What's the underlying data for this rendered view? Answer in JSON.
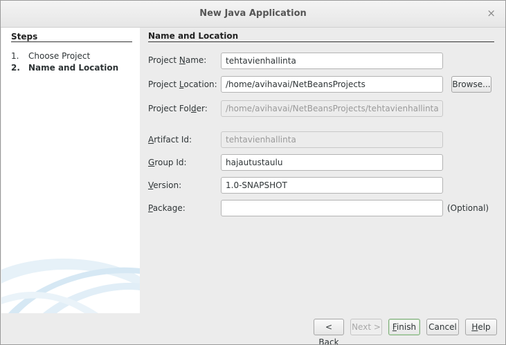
{
  "window": {
    "title": "New Java Application",
    "close_glyph": "×"
  },
  "steps": {
    "heading": "Steps",
    "items": [
      {
        "num": "1.",
        "label": "Choose Project"
      },
      {
        "num": "2.",
        "label": "Name and Location"
      }
    ]
  },
  "form": {
    "heading": "Name and Location",
    "project_name": {
      "pre": "Project ",
      "mnemonic": "N",
      "post": "ame:",
      "value": "tehtavienhallinta"
    },
    "project_location": {
      "pre": "Project ",
      "mnemonic": "L",
      "post": "ocation:",
      "value": "/home/avihavai/NetBeansProjects"
    },
    "project_folder": {
      "pre": "Project Fol",
      "mnemonic": "d",
      "post": "er:",
      "value": "/home/avihavai/NetBeansProjects/tehtavienhallinta"
    },
    "artifact_id": {
      "pre": "",
      "mnemonic": "A",
      "post": "rtifact Id:",
      "value": "tehtavienhallinta"
    },
    "group_id": {
      "pre": "",
      "mnemonic": "G",
      "post": "roup Id:",
      "value": "hajautustaulu"
    },
    "version": {
      "pre": "",
      "mnemonic": "V",
      "post": "ersion:",
      "value": "1.0-SNAPSHOT"
    },
    "package": {
      "pre": "",
      "mnemonic": "P",
      "post": "ackage:",
      "value": ""
    },
    "optional_hint": "(Optional)",
    "browse": {
      "pre": "Browse",
      "mnemonic": "",
      "post": "..."
    }
  },
  "buttons": {
    "back": {
      "pre": "< ",
      "mnemonic": "B",
      "post": "ack"
    },
    "next": {
      "pre": "Next >",
      "mnemonic": "",
      "post": ""
    },
    "finish": {
      "pre": "",
      "mnemonic": "F",
      "post": "inish"
    },
    "cancel": {
      "pre": "Cancel",
      "mnemonic": "",
      "post": ""
    },
    "help": {
      "pre": "",
      "mnemonic": "H",
      "post": "elp"
    }
  },
  "colors": {
    "accent_default_border": "#7fae7a",
    "swoosh": "#cfe3f1"
  }
}
